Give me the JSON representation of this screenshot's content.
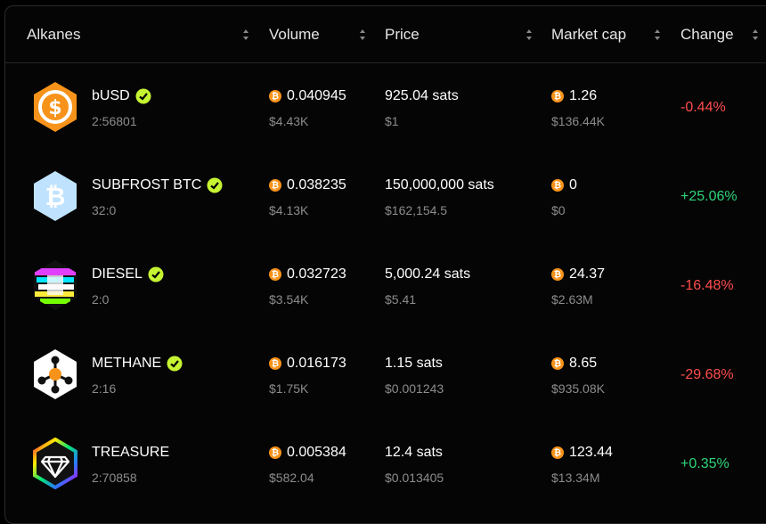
{
  "header": {
    "col_alkanes": "Alkanes",
    "col_volume": "Volume",
    "col_price": "Price",
    "col_market_cap": "Market cap",
    "col_change": "Change"
  },
  "rows": [
    {
      "name": "bUSD",
      "id": "2:56801",
      "volume": "0.040945",
      "volume_usd": "$4.43K",
      "price": "925.04 sats",
      "price_usd": "$1",
      "mcap": "1.26",
      "mcap_usd": "$136.44K",
      "change": "-0.44%",
      "logo": "dollar-coin-icon"
    },
    {
      "name": "SUBFROST BTC",
      "id": "32:0",
      "volume": "0.038235",
      "volume_usd": "$4.13K",
      "price": "150,000,000 sats",
      "price_usd": "$162,154.5",
      "mcap": "0",
      "mcap_usd": "$0",
      "change": "+25.06%",
      "logo": "bitcoin-hex-icon"
    },
    {
      "name": "DIESEL",
      "id": "2:0",
      "volume": "0.032723",
      "volume_usd": "$3.54K",
      "price": "5,000.24 sats",
      "price_usd": "$5.41",
      "mcap": "24.37",
      "mcap_usd": "$2.63M",
      "change": "-16.48%",
      "logo": "diesel-glitch-icon"
    },
    {
      "name": "METHANE",
      "id": "2:16",
      "volume": "0.016173",
      "volume_usd": "$1.75K",
      "price": "1.15 sats",
      "price_usd": "$0.001243",
      "mcap": "8.65",
      "mcap_usd": "$935.08K",
      "change": "-29.68%",
      "logo": "molecule-icon"
    },
    {
      "name": "TREASURE",
      "id": "2:70858",
      "volume": "0.005384",
      "volume_usd": "$582.04",
      "price": "12.4 sats",
      "price_usd": "$0.013405",
      "mcap": "123.44",
      "mcap_usd": "$13.34M",
      "change": "+0.35%",
      "logo": "diamond-icon"
    }
  ],
  "colors": {
    "negative": "#ff4d4d",
    "positive": "#2ed47a",
    "btc": "#f7931a",
    "verified": "#c6f432"
  }
}
